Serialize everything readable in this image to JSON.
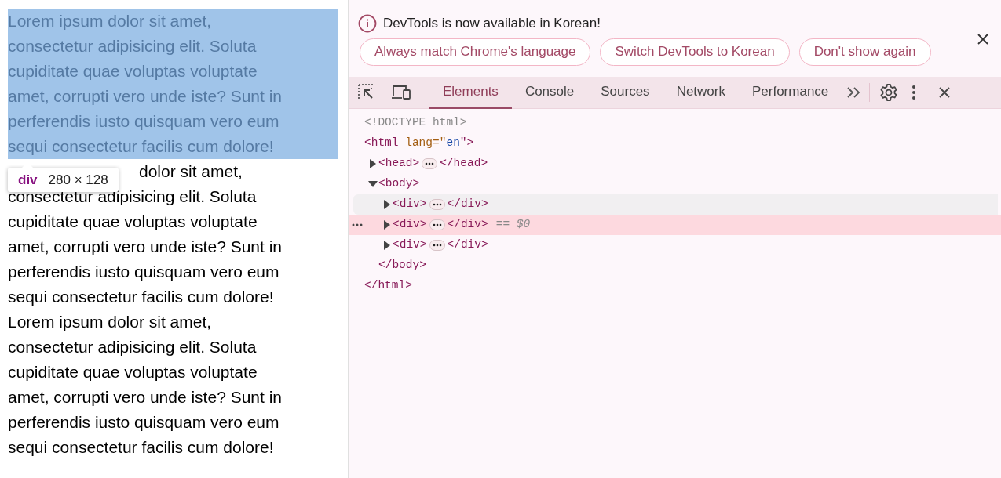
{
  "page": {
    "paragraphs": [
      {
        "highlighted": true,
        "partly_covered": false,
        "lines": [
          "Lorem ipsum dolor sit amet,",
          "consectetur adipisicing elit. Soluta",
          "cupiditate quae voluptas voluptate",
          "amet, corrupti vero unde iste? Sunt in",
          "perferendis iusto quisquam vero eum",
          "sequi consectetur facilis cum dolore!"
        ]
      },
      {
        "highlighted": false,
        "partly_covered": true,
        "lines": [
          "dolor sit amet,",
          "consectetur adipisicing elit. Soluta",
          "cupiditate quae voluptas voluptate",
          "amet, corrupti vero unde iste? Sunt in",
          "perferendis iusto quisquam vero eum",
          "sequi consectetur facilis cum dolore!"
        ]
      },
      {
        "highlighted": false,
        "partly_covered": false,
        "lines": [
          "Lorem ipsum dolor sit amet,",
          "consectetur adipisicing elit. Soluta",
          "cupiditate quae voluptas voluptate",
          "amet, corrupti vero unde iste? Sunt in",
          "perferendis iusto quisquam vero eum",
          "sequi consectetur facilis cum dolore!"
        ]
      }
    ]
  },
  "tooltip": {
    "tag": "div",
    "size": "280 × 128"
  },
  "devtools": {
    "infobar": {
      "message": "DevTools is now available in Korean!",
      "buttons": [
        "Always match Chrome's language",
        "Switch DevTools to Korean",
        "Don't show again"
      ]
    },
    "tabs": [
      {
        "label": "Elements",
        "selected": true
      },
      {
        "label": "Console",
        "selected": false
      },
      {
        "label": "Sources",
        "selected": false
      },
      {
        "label": "Network",
        "selected": false
      },
      {
        "label": "Performance",
        "selected": false
      }
    ],
    "tree": [
      {
        "tokens": [
          {
            "kind": "doctype",
            "text": "<!DOCTYPE html>"
          }
        ]
      },
      {
        "tokens": [
          {
            "kind": "tag",
            "text": "<html"
          },
          {
            "kind": "attr",
            "text": " lang=\""
          },
          {
            "kind": "value",
            "text": "en"
          },
          {
            "kind": "tag",
            "text": "\">"
          }
        ],
        "close": "</html>",
        "children": [
          {
            "tokens": [
              {
                "kind": "tag",
                "text": "<head>"
              }
            ],
            "close": "</head>",
            "expanded": false
          },
          {
            "tokens": [
              {
                "kind": "tag",
                "text": "<body>"
              }
            ],
            "close": "</body>",
            "expanded": true,
            "children": [
              {
                "tokens": [
                  {
                    "kind": "tag",
                    "text": "<div>"
                  }
                ],
                "close": "</div>",
                "expanded": false,
                "hovered": true,
                "selected": false
              },
              {
                "tokens": [
                  {
                    "kind": "tag",
                    "text": "<div>"
                  }
                ],
                "close": "</div>",
                "expanded": false,
                "hovered": false,
                "selected": true,
                "marker": "== $0"
              },
              {
                "tokens": [
                  {
                    "kind": "tag",
                    "text": "<div>"
                  }
                ],
                "close": "</div>",
                "expanded": false,
                "hovered": false,
                "selected": false
              }
            ]
          }
        ]
      }
    ]
  }
}
